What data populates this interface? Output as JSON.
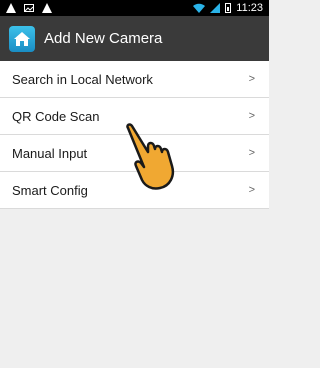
{
  "status_bar": {
    "time": "11:23",
    "left_icons": [
      "warning-icon",
      "image-icon",
      "warning-icon"
    ],
    "right_icons": [
      "wifi-icon",
      "signal-icon",
      "battery-icon"
    ]
  },
  "header": {
    "title": "Add New Camera",
    "icon": "home-icon"
  },
  "menu": {
    "items": [
      {
        "label": "Search in Local Network",
        "chevron": ">"
      },
      {
        "label": "QR Code Scan",
        "chevron": ">"
      },
      {
        "label": "Manual Input",
        "chevron": ">"
      },
      {
        "label": "Smart Config",
        "chevron": ">"
      }
    ]
  },
  "overlay": {
    "pointer_icon": "hand-pointer-icon",
    "pointer_color": "#f0a832"
  }
}
